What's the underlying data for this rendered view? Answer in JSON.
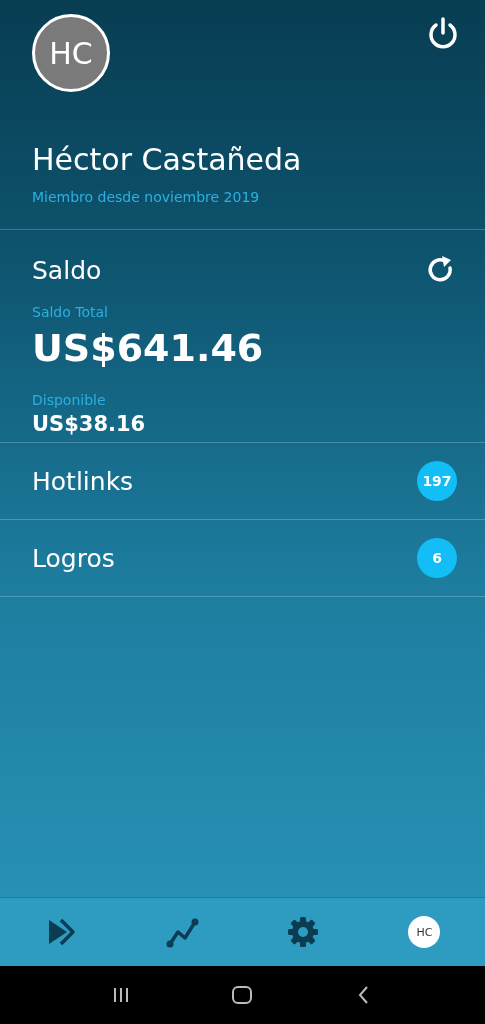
{
  "profile": {
    "initials": "HC",
    "name": "Héctor Castañeda",
    "member_since": "Miembro desde noviembre 2019"
  },
  "balance": {
    "title": "Saldo",
    "total_label": "Saldo Total",
    "total": "US$641.46",
    "available_label": "Disponible",
    "available": "US$38.16"
  },
  "menu": [
    {
      "label": "Hotlinks",
      "count": "197"
    },
    {
      "label": "Logros",
      "count": "6"
    }
  ],
  "tab_bar": [
    {
      "kind": "forward"
    },
    {
      "kind": "chart"
    },
    {
      "kind": "settings"
    },
    {
      "kind": "avatar",
      "initials": "HC"
    }
  ]
}
